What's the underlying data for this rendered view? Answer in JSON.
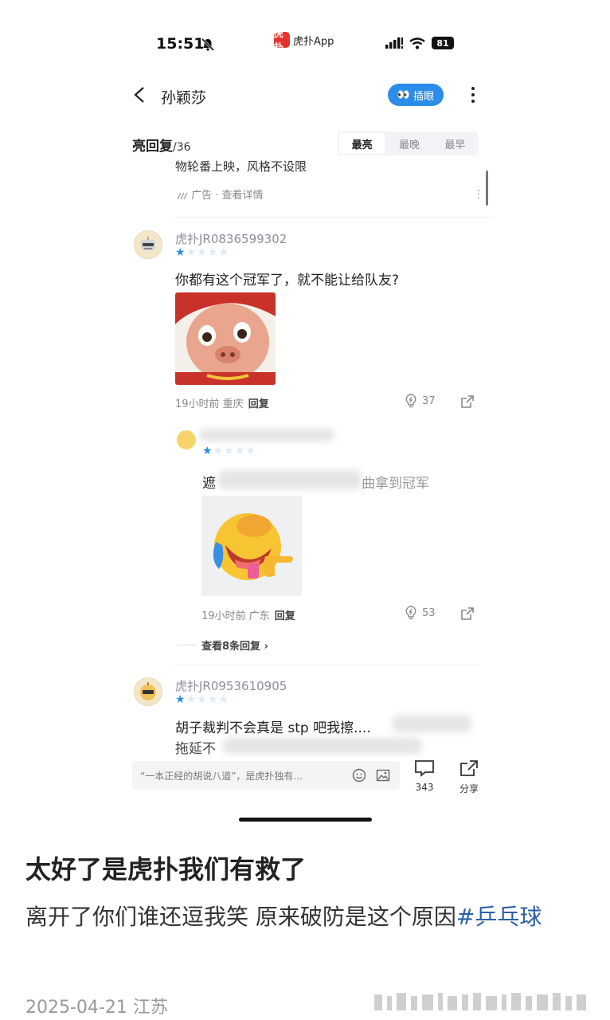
{
  "status_bar": {
    "time": "15:51",
    "app_name": "虎扑App",
    "app_logo_text": "虎扑",
    "battery": "81"
  },
  "nav": {
    "title": "孙颖莎",
    "insert_button": "插眼",
    "insert_emoji": "👀"
  },
  "replies_header": {
    "title": "亮回复",
    "count": "/36",
    "tabs": [
      "最亮",
      "最晚",
      "最早"
    ]
  },
  "ad": {
    "text": "物轮番上映，风格不设限",
    "meta": "广告 · 查看详情"
  },
  "comments": [
    {
      "username": "虎扑JR0836599302",
      "rating": 1,
      "text": "你都有这个冠军了，就不能让给队友?",
      "time_location": "19小时前 重庆",
      "reply_label": "回复",
      "likes": "37"
    },
    {
      "username": "",
      "rating": 1,
      "text": "遮",
      "text_tail": "曲拿到冠军",
      "time_location": "19小时前 广东",
      "reply_label": "回复",
      "likes": "53"
    },
    {
      "username": "虎扑JR0953610905",
      "rating": 1,
      "text": "胡子裁判不会真是 stp 吧我擦....",
      "text_line2": "拖延不"
    }
  ],
  "view_replies": "查看8条回复 ›",
  "bottom_bar": {
    "placeholder": "“一本正经的胡说八道”，是虎扑独有...",
    "comment_count": "343",
    "share_label": "分享"
  },
  "post": {
    "title": "太好了是虎扑我们有救了",
    "body": "离开了你们谁还逗我笑 原来破防是这个原因",
    "hashtag": "#乒乓球",
    "date_location": "2025-04-21 江苏"
  },
  "colors": {
    "accent_blue": "#2b8de8",
    "hashtag_blue": "#2d5fa8",
    "logo_red": "#e5322d"
  }
}
